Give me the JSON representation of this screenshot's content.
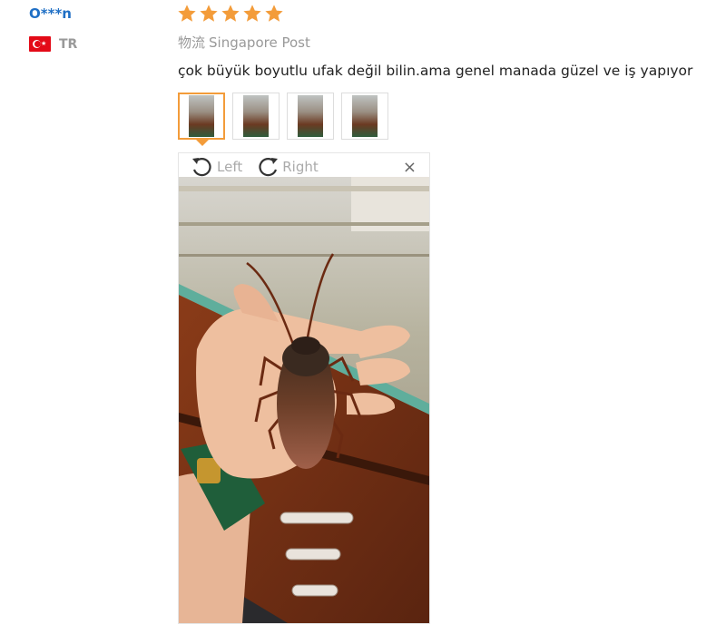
{
  "review": {
    "username": "O***n",
    "country_code": "TR",
    "rating": 5,
    "logistics_label": "物流",
    "logistics_value": "Singapore Post",
    "text": "çok büyük boyutlu ufak değil bilin.ama genel manada güzel ve iş yapıyor",
    "thumbnails": 4,
    "active_thumbnail": 1
  },
  "viewer": {
    "rotate_left_label": "Left",
    "rotate_right_label": "Right",
    "close_label": "×"
  },
  "colors": {
    "star": "#f39c3a",
    "username": "#1f6fc5",
    "active_border": "#f39c3a"
  },
  "icons": [
    "flag-turkey-icon",
    "star-icon",
    "rotate-left-icon",
    "rotate-right-icon",
    "close-icon"
  ]
}
